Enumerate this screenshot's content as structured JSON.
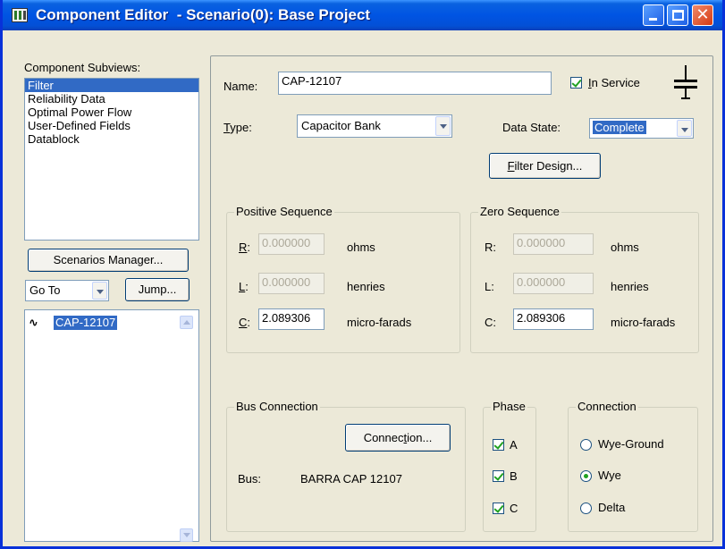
{
  "window": {
    "title": "Component Editor  - Scenario(0): Base Project"
  },
  "left": {
    "subviews_label": "Component Subviews:",
    "subviews": [
      {
        "label": "Filter",
        "selected": true
      },
      {
        "label": "Reliability Data",
        "selected": false
      },
      {
        "label": "Optimal Power Flow",
        "selected": false
      },
      {
        "label": "User-Defined Fields",
        "selected": false
      },
      {
        "label": "Datablock",
        "selected": false
      }
    ],
    "scenarios_button": "Scenarios Manager...",
    "goto_value": "Go To",
    "jump_button": "Jump...",
    "components": [
      {
        "icon": "capacitor-wave-icon",
        "label": "CAP-12107",
        "selected": true
      }
    ]
  },
  "form": {
    "name_label": "Name:",
    "name_value": "CAP-12107",
    "in_service_label": "In Service",
    "in_service_checked": true,
    "type_label": "Type:",
    "type_value": "Capacitor Bank",
    "data_state_label": "Data State:",
    "data_state_value": "Complete",
    "filter_design_button": "Filter Design..."
  },
  "positive_sequence": {
    "title": "Positive Sequence",
    "r_label": "R:",
    "r_value": "0.000000",
    "r_unit": "ohms",
    "l_label": "L:",
    "l_value": "0.000000",
    "l_unit": "henries",
    "c_label": "C:",
    "c_value": "2.089306",
    "c_unit": "micro-farads"
  },
  "zero_sequence": {
    "title": "Zero Sequence",
    "r_label": "R:",
    "r_value": "0.000000",
    "r_unit": "ohms",
    "l_label": "L:",
    "l_value": "0.000000",
    "l_unit": "henries",
    "c_label": "C:",
    "c_value": "2.089306",
    "c_unit": "micro-farads"
  },
  "bus_connection": {
    "title": "Bus Connection",
    "button": "Connection...",
    "bus_label": "Bus:",
    "bus_value": "BARRA CAP 12107"
  },
  "phase": {
    "title": "Phase",
    "a": "A",
    "b": "B",
    "c": "C",
    "a_checked": true,
    "b_checked": true,
    "c_checked": true
  },
  "connection": {
    "title": "Connection",
    "options": [
      "Wye-Ground",
      "Wye",
      "Delta"
    ],
    "selected": "Wye"
  }
}
